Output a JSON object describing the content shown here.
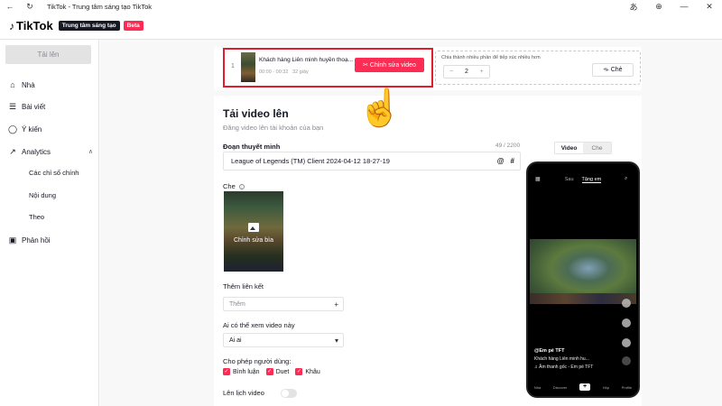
{
  "window": {
    "title": "TikTok - Trung tâm sáng tạo TikTok",
    "back_icon": "←",
    "refresh_icon": "↻",
    "translate_icon": "あ",
    "zoom_icon": "⊕",
    "minimize_icon": "—",
    "close_icon": "✕"
  },
  "header": {
    "logo_text": "TikTok",
    "creator_badge": "Trung tâm sáng tạo",
    "beta_badge": "Beta"
  },
  "sidebar": {
    "upload_label": "Tải lên",
    "items": [
      {
        "label": "Nhà",
        "icon": "⌂"
      },
      {
        "label": "Bài viết",
        "icon": "☰"
      },
      {
        "label": "Ý kiến",
        "icon": "◯"
      },
      {
        "label": "Analytics",
        "icon": "↗"
      },
      {
        "label": "Phản hồi",
        "icon": "▣"
      }
    ],
    "analytics_sub": [
      "Các chỉ số chính",
      "Nội dung",
      "Theo"
    ],
    "analytics_chevron": "∧"
  },
  "video_card": {
    "index": "1",
    "title": "Khách hàng Liên minh huyền thoạ...",
    "duration": "00:00 - 00:32",
    "size": "32 giây",
    "edit_button": "Chỉnh sửa video",
    "edit_icon": "✂"
  },
  "split": {
    "label": "Chia thành nhiều phần để tiếp xúc nhiều hơn",
    "value": "2",
    "minus": "−",
    "plus": "+",
    "button": "Chẻ",
    "button_icon": "⟛"
  },
  "form": {
    "title": "Tải video lên",
    "subtitle": "Đăng video lên tài khoản của bạn",
    "caption_label": "Đoạn thuyết minh",
    "caption_counter": "49 / 2200",
    "caption_value": "League of Legends (TM) Client 2024-04-12 18-27-19",
    "mention_icon": "@",
    "hashtag_icon": "#",
    "cover_label": "Che",
    "cover_info": "i",
    "cover_edit": "Chỉnh sửa bìa",
    "link_label": "Thêm liên kết",
    "link_placeholder": "Thêm",
    "link_plus": "+",
    "privacy_label": "Ai có thể xem video này",
    "privacy_value": "Ai ai",
    "privacy_chevron": "▾",
    "allow_label": "Cho phép người dùng:",
    "allow_options": [
      {
        "label": "Bình luận",
        "checked": true
      },
      {
        "label": "Duet",
        "checked": true
      },
      {
        "label": "Khâu",
        "checked": true
      }
    ],
    "check_mark": "✓",
    "schedule_label": "Lên lịch video",
    "schedule_on": false
  },
  "preview": {
    "tab_video": "Video",
    "tab_cover": "Che",
    "top_left_icon": "▦",
    "top_tabs": [
      "Sau",
      "Tặng em"
    ],
    "search_icon": "⌕",
    "username": "@Em pé TFT",
    "caption": "Khách hàng Liên minh hu...",
    "sound": "♫ Âm thanh gốc - Em pé TFT",
    "nav": [
      "Nhà",
      "Discover",
      "+",
      "Hộp",
      "Profile"
    ]
  },
  "pointer": "☝"
}
